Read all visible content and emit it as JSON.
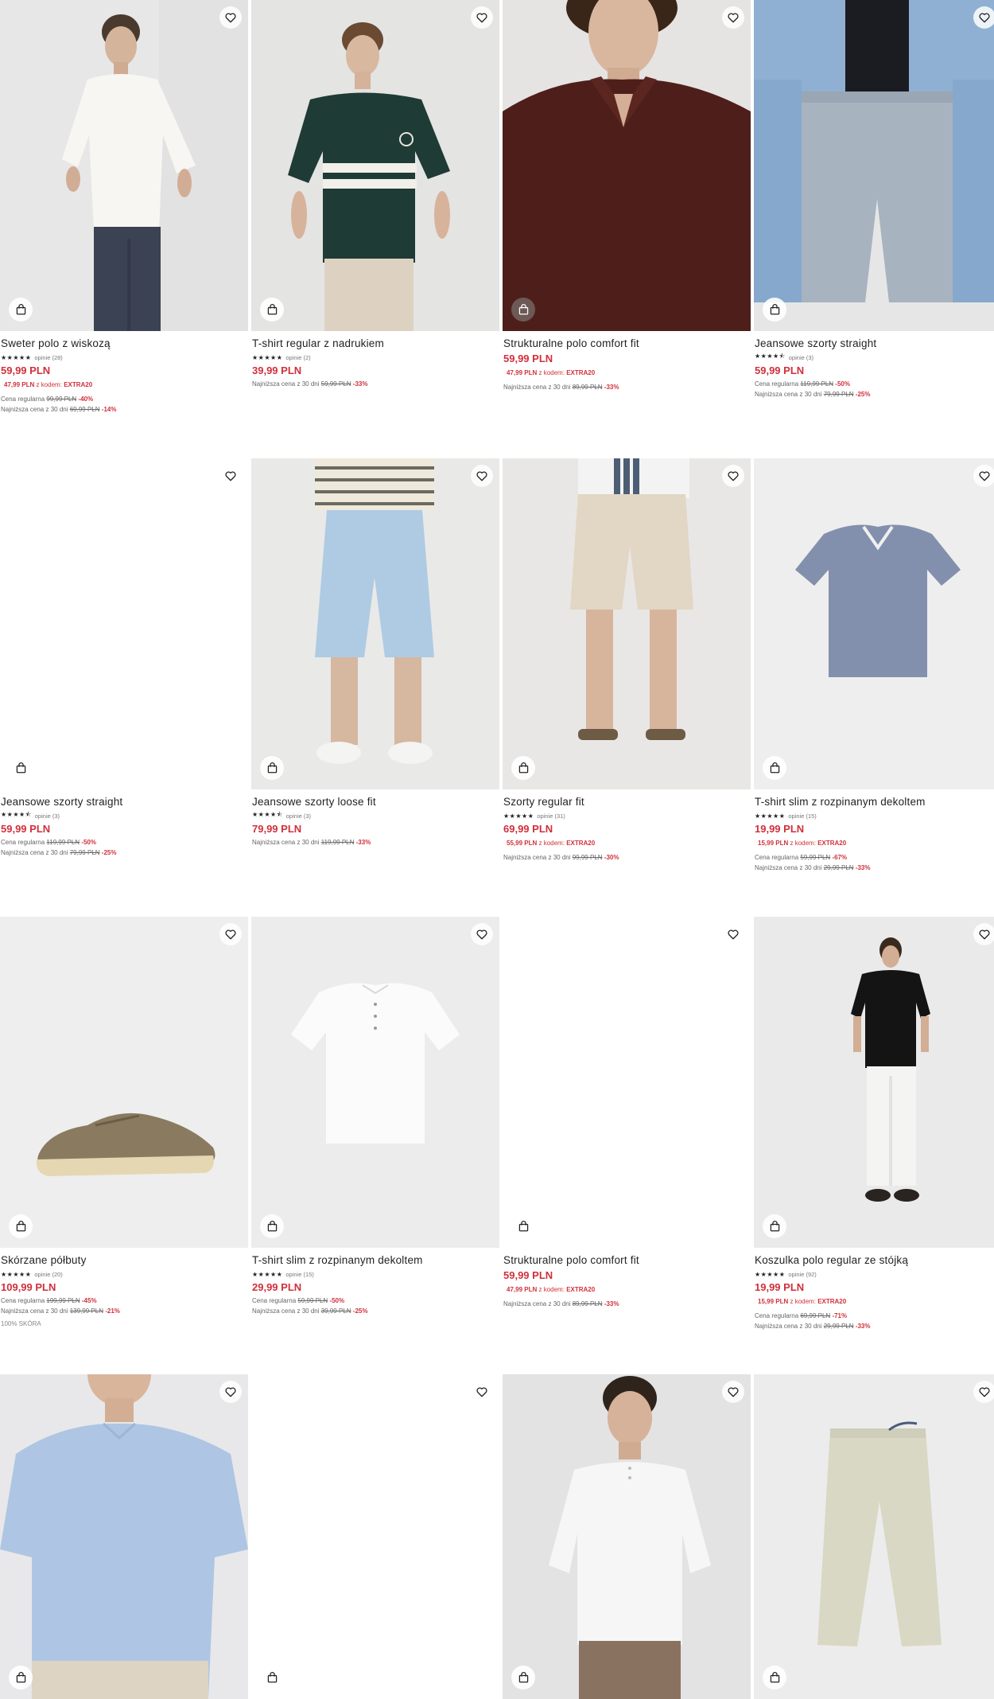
{
  "products": [
    {
      "name": "Sweter polo z wiskozą",
      "stars": "★★★★★",
      "reviews": "opinie (28)",
      "price": "59,99 PLN",
      "promo": {
        "price": "47,99 PLN",
        "label": "z kodem:",
        "code": "EXTRA20"
      },
      "regular": {
        "label": "Cena regularna",
        "old": "99,99 PLN",
        "disc": "-40%"
      },
      "lowest": {
        "label": "Najniższa cena z 30 dni",
        "old": "69,99 PLN",
        "disc": "-14%"
      }
    },
    {
      "name": "T-shirt regular z nadrukiem",
      "stars": "★★★★★",
      "reviews": "opinie (2)",
      "price": "39,99 PLN",
      "lowest": {
        "label": "Najniższa cena z 30 dni",
        "old": "59,99 PLN",
        "disc": "-33%"
      }
    },
    {
      "name": "Strukturalne polo comfort fit",
      "price": "59,99 PLN",
      "promo": {
        "price": "47,99 PLN",
        "label": "z kodem:",
        "code": "EXTRA20"
      },
      "lowest": {
        "label": "Najniższa cena z 30 dni",
        "old": "89,99 PLN",
        "disc": "-33%"
      }
    },
    {
      "name": "Jeansowe szorty straight",
      "stars": "★★★★⯪",
      "reviews": "opinie (3)",
      "price": "59,99 PLN",
      "regular": {
        "label": "Cena regularna",
        "old": "119,99 PLN",
        "disc": "-50%"
      },
      "lowest": {
        "label": "Najniższa cena z 30 dni",
        "old": "79,99 PLN",
        "disc": "-25%"
      }
    },
    {
      "name": "Jeansowe szorty straight",
      "stars": "★★★★⯪",
      "reviews": "opinie (3)",
      "price": "59,99 PLN",
      "regular": {
        "label": "Cena regularna",
        "old": "119,99 PLN",
        "disc": "-50%"
      },
      "lowest": {
        "label": "Najniższa cena z 30 dni",
        "old": "79,99 PLN",
        "disc": "-25%"
      }
    },
    {
      "name": "Jeansowe szorty loose fit",
      "stars": "★★★★⯪",
      "reviews": "opinie (3)",
      "price": "79,99 PLN",
      "lowest": {
        "label": "Najniższa cena z 30 dni",
        "old": "119,99 PLN",
        "disc": "-33%"
      }
    },
    {
      "name": "Szorty regular fit",
      "stars": "★★★★★",
      "reviews": "opinie (31)",
      "price": "69,99 PLN",
      "promo": {
        "price": "55,99 PLN",
        "label": "z kodem:",
        "code": "EXTRA20"
      },
      "lowest": {
        "label": "Najniższa cena z 30 dni",
        "old": "99,99 PLN",
        "disc": "-30%"
      }
    },
    {
      "name": "T-shirt slim z rozpinanym dekoltem",
      "stars": "★★★★★",
      "reviews": "opinie (15)",
      "price": "19,99 PLN",
      "promo": {
        "price": "15,99 PLN",
        "label": "z kodem:",
        "code": "EXTRA20"
      },
      "regular": {
        "label": "Cena regularna",
        "old": "59,99 PLN",
        "disc": "-67%"
      },
      "lowest": {
        "label": "Najniższa cena z 30 dni",
        "old": "29,99 PLN",
        "disc": "-33%"
      }
    },
    {
      "name": "Skórzane półbuty",
      "stars": "★★★★★",
      "reviews": "opinie (20)",
      "price": "109,99 PLN",
      "regular": {
        "label": "Cena regularna",
        "old": "199,99 PLN",
        "disc": "-45%"
      },
      "lowest": {
        "label": "Najniższa cena z 30 dni",
        "old": "139,99 PLN",
        "disc": "-21%"
      },
      "extra": "100% SKÓRA"
    },
    {
      "name": "T-shirt slim z rozpinanym dekoltem",
      "stars": "★★★★★",
      "reviews": "opinie (15)",
      "price": "29,99 PLN",
      "regular": {
        "label": "Cena regularna",
        "old": "59,99 PLN",
        "disc": "-50%"
      },
      "lowest": {
        "label": "Najniższa cena z 30 dni",
        "old": "39,99 PLN",
        "disc": "-25%"
      }
    },
    {
      "name": "Strukturalne polo comfort fit",
      "price": "59,99 PLN",
      "promo": {
        "price": "47,99 PLN",
        "label": "z kodem:",
        "code": "EXTRA20"
      },
      "lowest": {
        "label": "Najniższa cena z 30 dni",
        "old": "89,99 PLN",
        "disc": "-33%"
      }
    },
    {
      "name": "Koszulka polo regular ze stójką",
      "stars": "★★★★★",
      "reviews": "opinie (92)",
      "price": "19,99 PLN",
      "promo": {
        "price": "15,99 PLN",
        "label": "z kodem:",
        "code": "EXTRA20"
      },
      "regular": {
        "label": "Cena regularna",
        "old": "69,99 PLN",
        "disc": "-71%"
      },
      "lowest": {
        "label": "Najniższa cena z 30 dni",
        "old": "29,99 PLN",
        "disc": "-33%"
      }
    },
    {
      "image": "light-blue-henley"
    },
    {
      "image": "blank"
    },
    {
      "image": "white-henley"
    },
    {
      "image": "beige-chinos"
    }
  ],
  "icons": {
    "favorite": "heart-icon",
    "cart": "shopping-bag-icon"
  },
  "colors": {
    "price": "#d0303b",
    "text": "#222222",
    "muted": "#666666"
  }
}
